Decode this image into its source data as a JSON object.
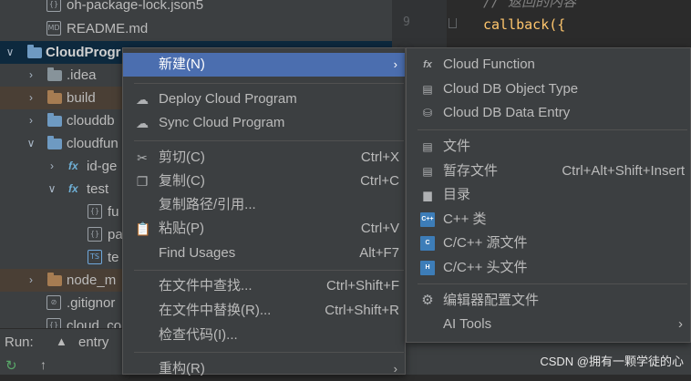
{
  "tree": {
    "items": [
      {
        "label": "oh-package-lock.json5",
        "type": "json"
      },
      {
        "label": "README.md",
        "type": "md"
      },
      {
        "label": "CloudProgr",
        "type": "module"
      },
      {
        "label": ".idea"
      },
      {
        "label": "build"
      },
      {
        "label": "clouddb"
      },
      {
        "label": "cloudfun"
      },
      {
        "label": "id-ge"
      },
      {
        "label": "test"
      },
      {
        "label": "fu"
      },
      {
        "label": "pa"
      },
      {
        "label": "te"
      },
      {
        "label": "node_m"
      },
      {
        "label": ".gitignor"
      },
      {
        "label": "cloud_co"
      }
    ]
  },
  "editor": {
    "line_number": "9",
    "comment": "//  返回的内容",
    "code": "callback({"
  },
  "runbar": {
    "label": "Run:",
    "tab": "entry"
  },
  "context_menu": {
    "items": [
      {
        "label": "新建(N)",
        "shortcut": "",
        "icon": "",
        "submenu": true
      },
      {
        "label": "Deploy Cloud Program",
        "shortcut": "",
        "icon": "cloud-upload-icon"
      },
      {
        "label": "Sync Cloud Program",
        "shortcut": "",
        "icon": "cloud-sync-icon"
      },
      {
        "label": "剪切(C)",
        "shortcut": "Ctrl+X",
        "icon": "scissors-icon"
      },
      {
        "label": "复制(C)",
        "shortcut": "Ctrl+C",
        "icon": "copy-icon"
      },
      {
        "label": "复制路径/引用...",
        "shortcut": "",
        "icon": ""
      },
      {
        "label": "粘贴(P)",
        "shortcut": "Ctrl+V",
        "icon": "clipboard-icon"
      },
      {
        "label": "Find Usages",
        "shortcut": "Alt+F7",
        "icon": ""
      },
      {
        "label": "在文件中查找...",
        "shortcut": "Ctrl+Shift+F",
        "icon": ""
      },
      {
        "label": "在文件中替换(R)...",
        "shortcut": "Ctrl+Shift+R",
        "icon": ""
      },
      {
        "label": "检查代码(I)...",
        "shortcut": "",
        "icon": ""
      },
      {
        "label": "重构(R)",
        "shortcut": "",
        "icon": "",
        "submenu": true
      }
    ]
  },
  "submenu": {
    "items": [
      {
        "label": "Cloud Function",
        "shortcut": "",
        "icon": "fx"
      },
      {
        "label": "Cloud DB Object Type",
        "shortcut": "",
        "icon": "table-icon"
      },
      {
        "label": "Cloud DB Data Entry",
        "shortcut": "",
        "icon": "database-icon"
      },
      {
        "label": "文件",
        "shortcut": "",
        "icon": "file-icon"
      },
      {
        "label": "暂存文件",
        "shortcut": "Ctrl+Alt+Shift+Insert",
        "icon": "scratch-file-icon"
      },
      {
        "label": "目录",
        "shortcut": "",
        "icon": "folder-icon"
      },
      {
        "label": "C++ 类",
        "shortcut": "",
        "icon": "cpp-class-icon",
        "badge": "C++"
      },
      {
        "label": "C/C++ 源文件",
        "shortcut": "",
        "icon": "c-source-icon",
        "badge": "C"
      },
      {
        "label": "C/C++ 头文件",
        "shortcut": "",
        "icon": "c-header-icon",
        "badge": "H"
      },
      {
        "label": "编辑器配置文件",
        "shortcut": "",
        "icon": "gear-icon"
      },
      {
        "label": "AI Tools",
        "shortcut": "",
        "icon": "",
        "submenu": true
      }
    ]
  },
  "watermark": "CSDN @拥有一颗学徒的心",
  "colors": {
    "menu_bg": "#3c3f41",
    "highlight": "#4b6eaf",
    "excluded_folder_bg": "#4a3f35",
    "text": "#bbbbbb",
    "code_fn": "#ffc66d"
  }
}
